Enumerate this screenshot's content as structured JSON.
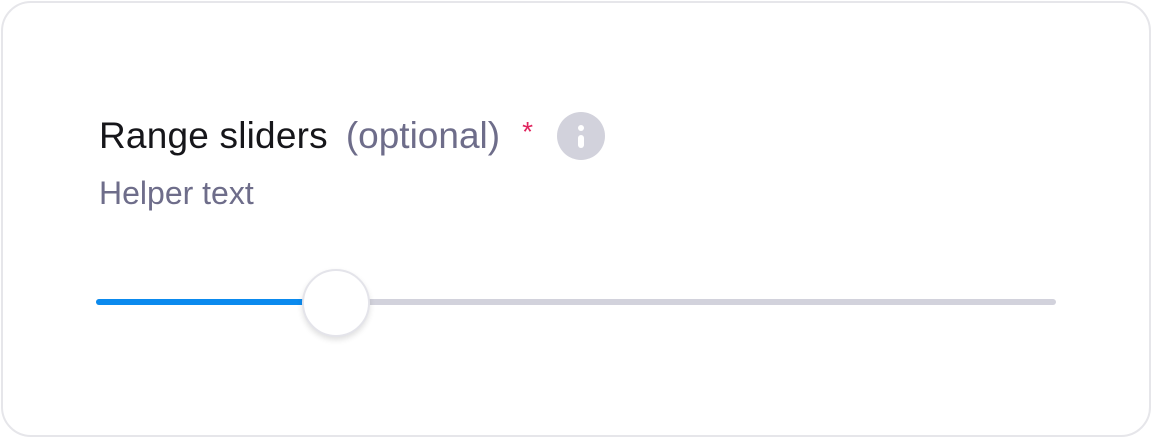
{
  "field": {
    "label": "Range sliders",
    "optional_text": "(optional)",
    "required_marker": "*",
    "info_icon": "info-icon",
    "helper_text": "Helper text"
  },
  "slider": {
    "min": 0,
    "max": 100,
    "value": 25,
    "fill_color": "#0b8aee",
    "track_color": "#d2d2dc"
  },
  "colors": {
    "label": "#16161a",
    "muted": "#6e6d8a",
    "required": "#e0245e"
  }
}
